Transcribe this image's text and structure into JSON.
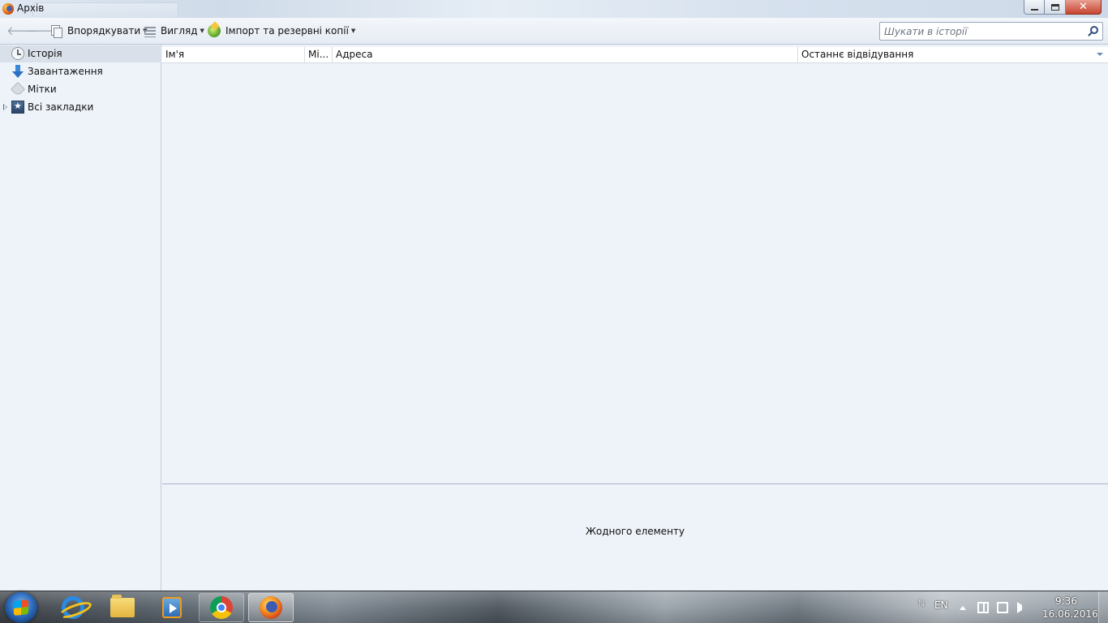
{
  "window": {
    "title": "Архів"
  },
  "toolbar": {
    "organize_label": "Впорядкувати",
    "view_label": "Вигляд",
    "import_label": "Імпорт та резервні копії",
    "search_placeholder": "Шукати в історії"
  },
  "sidebar": {
    "items": [
      {
        "label": "Історія",
        "icon": "clock-icon",
        "selected": true
      },
      {
        "label": "Завантаження",
        "icon": "download-icon",
        "selected": false
      },
      {
        "label": "Мітки",
        "icon": "tag-icon",
        "selected": false
      },
      {
        "label": "Всі закладки",
        "icon": "bookmarks-star-icon",
        "selected": false
      }
    ]
  },
  "table": {
    "columns": [
      "Ім'я",
      "Мі...",
      "Адреса",
      "Останнє відвідування"
    ],
    "rows": []
  },
  "details": {
    "empty_message": "Жодного елементу"
  },
  "taskbar": {
    "apps": [
      "internet-explorer",
      "file-explorer",
      "media-player",
      "chrome",
      "firefox"
    ],
    "language": "EN",
    "time": "9:36",
    "date": "16.06.2016"
  },
  "colors": {
    "background": "#eef3fa",
    "selection": "#d9e0e9",
    "accent": "#2b6fc2"
  }
}
